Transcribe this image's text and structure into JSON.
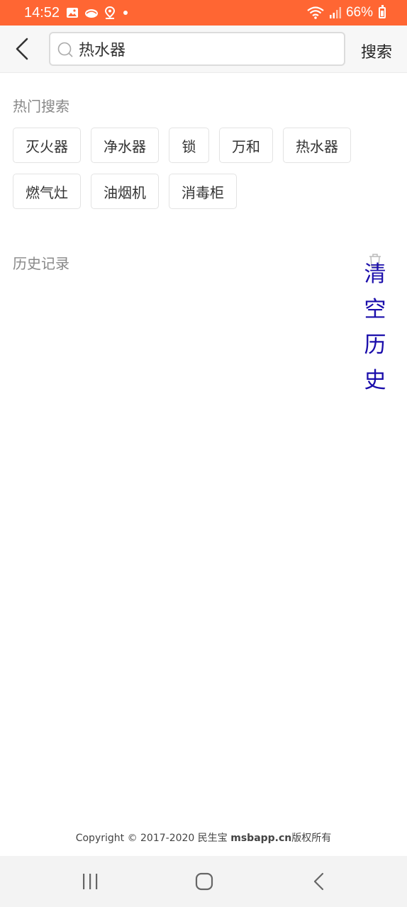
{
  "status_bar": {
    "time": "14:52",
    "battery": "66%",
    "battery_level": 0.66,
    "color": "#ff6633"
  },
  "search": {
    "value": "热水器",
    "placeholder": "",
    "button_label": "搜索"
  },
  "hot_search": {
    "title": "热门搜索",
    "tags": [
      "灭火器",
      "净水器",
      "锁",
      "万和",
      "热水器",
      "燃气灶",
      "油烟机",
      "消毒柜"
    ]
  },
  "history": {
    "title": "历史记录",
    "clear_label": "清空历史",
    "link_color": "#1a0dab"
  },
  "footer": {
    "copyright_prefix": "Copyright © 2017-2020 民生宝 ",
    "copyright_domain": "msbapp.cn",
    "copyright_suffix": "版权所有"
  },
  "icons": {
    "back": "chevron-left-icon",
    "search": "search-icon",
    "trash": "trash-icon",
    "nav_recent": "recent-apps-icon",
    "nav_home": "home-icon",
    "nav_back": "back-icon"
  }
}
